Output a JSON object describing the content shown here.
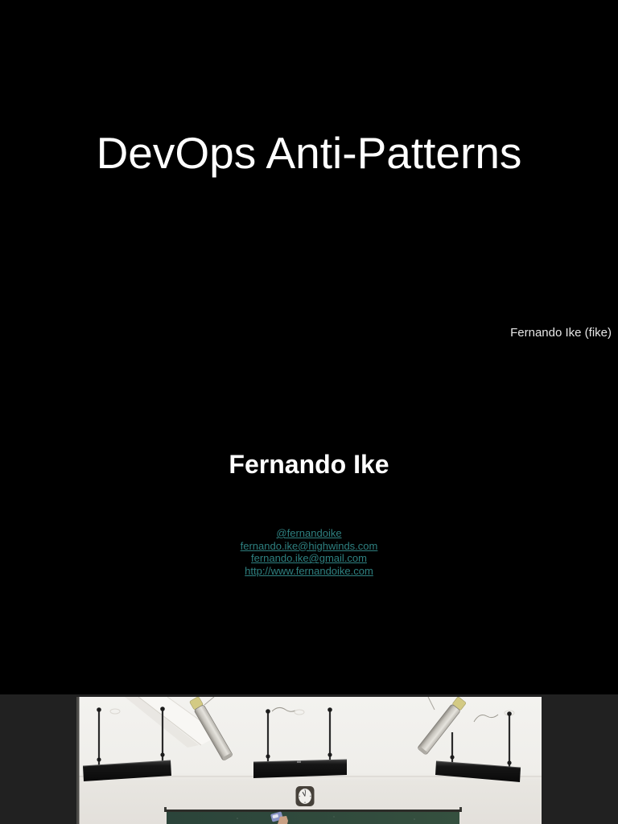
{
  "viewer": {
    "background_color": "#212121"
  },
  "slide1": {
    "title": "DevOps Anti-Patterns",
    "presenter_credit": "Fernando Ike (fike)",
    "presenter_name": "Fernando Ike",
    "links": [
      "@fernandoike",
      "fernando.ike@highwinds.com",
      "fernando.ike@gmail.com",
      "http://www.fernandoike.com"
    ],
    "colors": {
      "background": "#000000",
      "title_text": "#ffffff",
      "credit_text": "#e6e6e6",
      "name_text": "#ffffff",
      "link_text": "#2e8080"
    }
  },
  "slide2": {
    "photo_colors": {
      "wall": "#eeede9",
      "ceiling": "#f3f2ef",
      "light_fixture": "#141414",
      "fluorescent_tube": "#d6d3cc",
      "tube_cap": "#d3ca83",
      "chalkboard": "#2f483c",
      "clock_face": "#f0efeb"
    }
  }
}
